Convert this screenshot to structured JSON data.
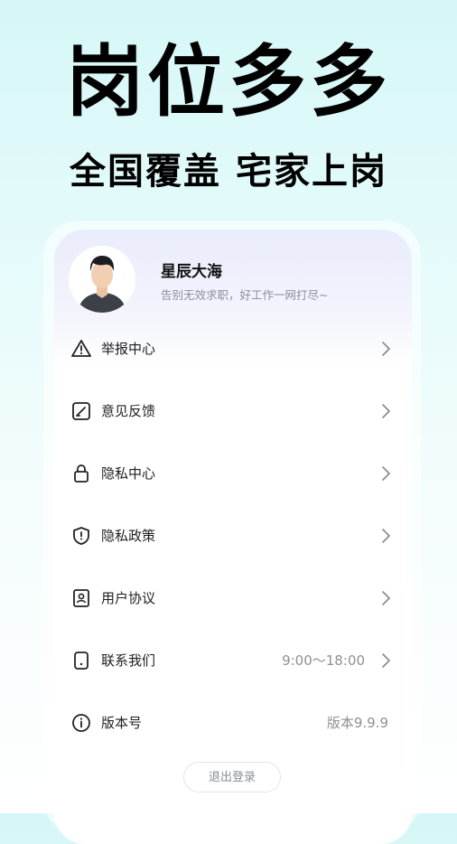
{
  "hero": {
    "title": "岗位多多",
    "subtitle": "全国覆盖 宅家上岗"
  },
  "profile": {
    "name": "星辰大海",
    "bio": "告别无效求职，好工作一网打尽~",
    "avatar_icon": "user-avatar"
  },
  "menu": [
    {
      "label": "举报中心",
      "icon": "warning-icon",
      "value": "",
      "chevron": true
    },
    {
      "label": "意见反馈",
      "icon": "feedback-edit-icon",
      "value": "",
      "chevron": true
    },
    {
      "label": "隐私中心",
      "icon": "lock-icon",
      "value": "",
      "chevron": true
    },
    {
      "label": "隐私政策",
      "icon": "shield-icon",
      "value": "",
      "chevron": true
    },
    {
      "label": "用户协议",
      "icon": "user-card-icon",
      "value": "",
      "chevron": true
    },
    {
      "label": "联系我们",
      "icon": "phone-icon",
      "value": "9:00～18:00",
      "chevron": true
    },
    {
      "label": "版本号",
      "icon": "info-icon",
      "value": "版本9.9.9",
      "chevron": false
    }
  ],
  "logout_label": "退出登录",
  "colors": {
    "accent_bg_top": "#d6f7f7",
    "card_header": "#e9ecfb",
    "muted_text": "#8d9097"
  }
}
